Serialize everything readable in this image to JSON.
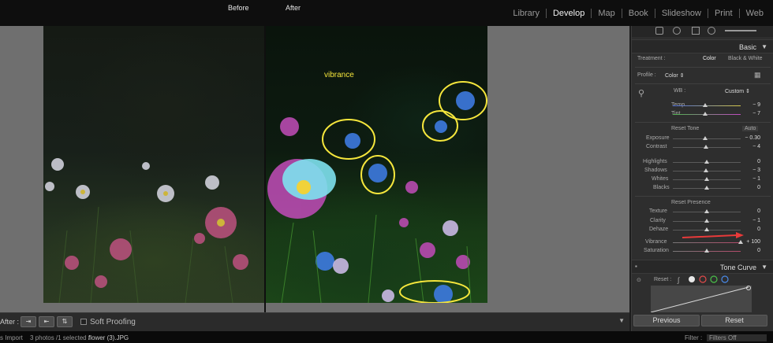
{
  "header": {
    "before_label": "Before",
    "after_label": "After",
    "modules": [
      "Library",
      "Develop",
      "Map",
      "Book",
      "Slideshow",
      "Print",
      "Web"
    ],
    "active_module": "Develop"
  },
  "canvas": {
    "annotation_text": "vibrance",
    "annotation_color": "#f5e63c"
  },
  "toolbar": {
    "after_label": "After :",
    "soft_proofing": "Soft Proofing",
    "menu_arrow": "▼"
  },
  "status": {
    "import": "s Import",
    "selection": "3 photos /1 selected /",
    "filename": "flower (3).JPG",
    "filter_label": "Filter :",
    "filter_value": "Filters Off"
  },
  "panel": {
    "basic_title": "Basic",
    "treatment_label": "Treatment :",
    "treatment_color": "Color",
    "treatment_bw": "Black & White",
    "profile_label": "Profile :",
    "profile_value": "Color ⇕",
    "wb_label": "WB :",
    "wb_value": "Custom ⇕",
    "reset_tone": "Reset Tone",
    "auto": "Auto",
    "reset_presence": "Reset Presence",
    "tone_curve_title": "Tone Curve",
    "tc_reset": "Reset :",
    "previous": "Previous",
    "reset": "Reset",
    "sliders": {
      "temp": {
        "label": "Temp",
        "value": "− 9",
        "level": 0.48
      },
      "tint": {
        "label": "Tint",
        "value": "− 7",
        "level": 0.48
      },
      "exposure": {
        "label": "Exposure",
        "value": "− 0.30",
        "level": 0.48
      },
      "contrast": {
        "label": "Contrast",
        "value": "− 4",
        "level": 0.49
      },
      "highlights": {
        "label": "Highlights",
        "value": "0",
        "level": 0.5
      },
      "shadows": {
        "label": "Shadows",
        "value": "− 3",
        "level": 0.49
      },
      "whites": {
        "label": "Whites",
        "value": "− 1",
        "level": 0.5
      },
      "blacks": {
        "label": "Blacks",
        "value": "0",
        "level": 0.5
      },
      "texture": {
        "label": "Texture",
        "value": "0",
        "level": 0.5
      },
      "clarity": {
        "label": "Clarity",
        "value": "− 1",
        "level": 0.5
      },
      "dehaze": {
        "label": "Dehaze",
        "value": "0",
        "level": 0.5
      },
      "vibrance": {
        "label": "Vibrance",
        "value": "+ 100",
        "level": 1.0
      },
      "saturation": {
        "label": "Saturation",
        "value": "0",
        "level": 0.5
      }
    }
  }
}
